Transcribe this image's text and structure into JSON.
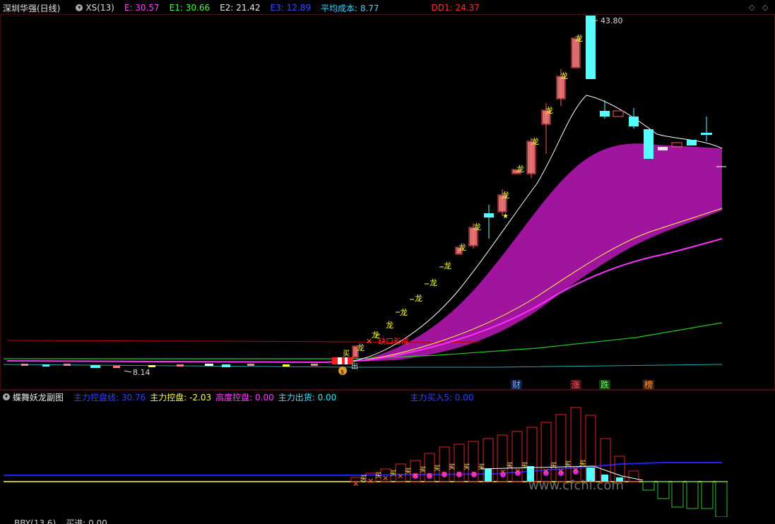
{
  "header": {
    "stock_title": "深圳华强(日线)",
    "indicator": "XS(13)",
    "e_label": "E: 30.57",
    "e1_label": "E1: 30.66",
    "e2_label": "E2: 21.42",
    "e3_label": "E3: 12.89",
    "avg_cost": "平均成本: 8.77",
    "dd1": "DD1: 24.37"
  },
  "chart_labels": {
    "high": "43.80",
    "low": "8.14",
    "jiekou": "缺口形成",
    "chu": "出",
    "dragon": "龙",
    "mai": "买"
  },
  "event_markers": [
    {
      "text": "财",
      "color": "#6ab0ff",
      "bg": "#102040"
    },
    {
      "text": "涨",
      "color": "#ff6060",
      "bg": "#401010"
    },
    {
      "text": "跌",
      "color": "#60ff60",
      "bg": "#104010"
    },
    {
      "text": "榜",
      "color": "#ff9a40",
      "bg": "#402410"
    }
  ],
  "sub_header": {
    "title": "蝶舞妖龙副图",
    "line1": "主力控盘线: 30.76",
    "line2": "主力控盘: -2.03",
    "line3": "高度控盘: 0.00",
    "line4": "主力出货: 0.00",
    "line5": "主力买入5: 0.00"
  },
  "bottom_header": {
    "title": "BBY(13.6)",
    "value": "买进: 0.00"
  },
  "watermark": "www.cfchi.com",
  "colors": {
    "up": "#ff5a5a",
    "up_fill": "#ff8080",
    "down": "#55ffff",
    "magenta": "#a0149e",
    "white_line": "#ffffff",
    "green_line": "#22cc22",
    "cyan_line": "#22aaaa",
    "red_line": "#c00000",
    "blue_line": "#2020ff",
    "yellow": "#ffff40"
  }
}
